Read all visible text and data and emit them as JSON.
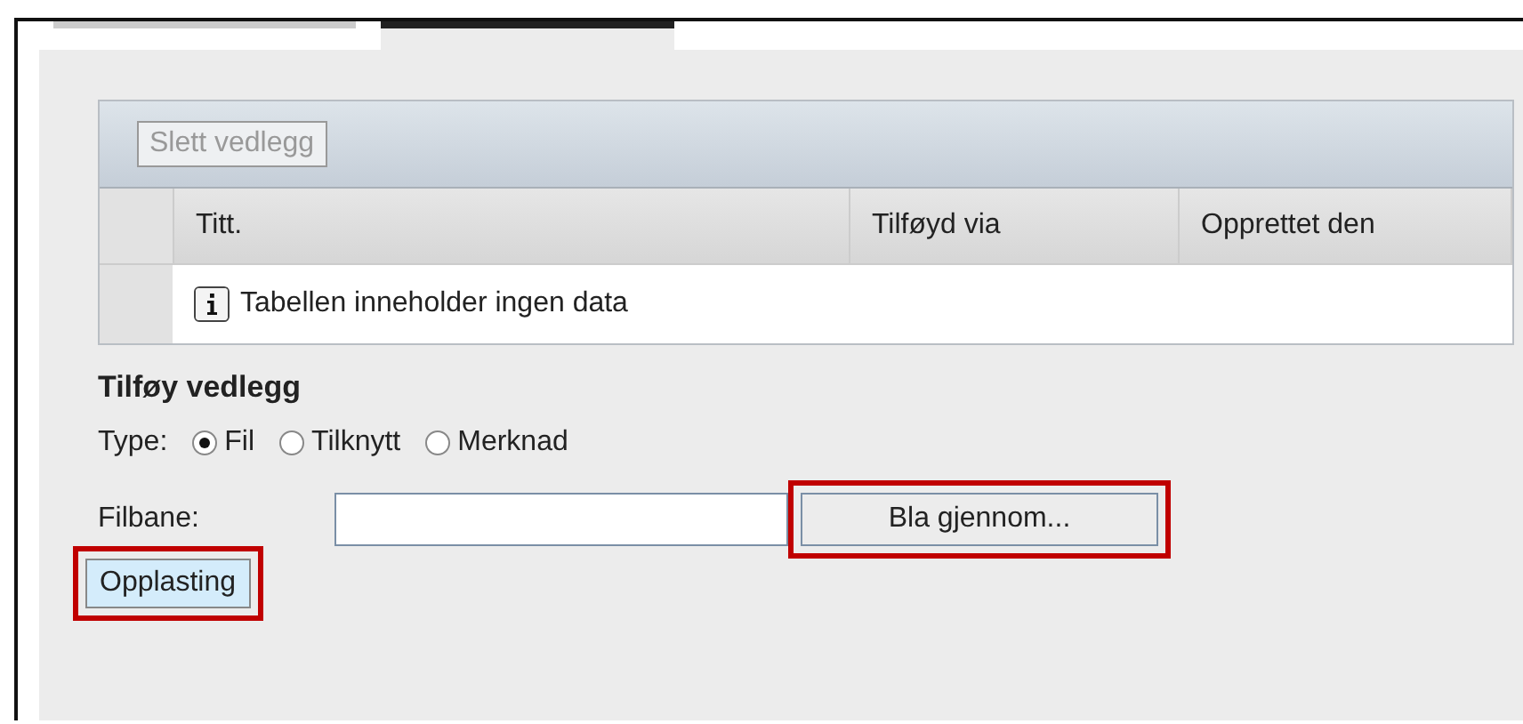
{
  "tabs": [
    {
      "selected": false
    },
    {
      "selected": true
    }
  ],
  "toolbar": {
    "buttons": [
      {
        "label": "Slett vedlegg",
        "disabled": true
      }
    ]
  },
  "table": {
    "columns": [
      "Titt.",
      "Tilføyd via",
      "Opprettet den"
    ],
    "empty_message": "Tabellen inneholder ingen data"
  },
  "add_attachment": {
    "heading": "Tilføy vedlegg",
    "type_label": "Type:",
    "type_options": [
      {
        "label": "Fil",
        "selected": true
      },
      {
        "label": "Tilknytt",
        "selected": false
      },
      {
        "label": "Merknad",
        "selected": false
      }
    ],
    "path_label": "Filbane:",
    "browse_button": {
      "label": "Bla gjennom...",
      "highlighted": true
    },
    "upload_button": {
      "label": "Opplasting",
      "highlighted": true
    }
  }
}
